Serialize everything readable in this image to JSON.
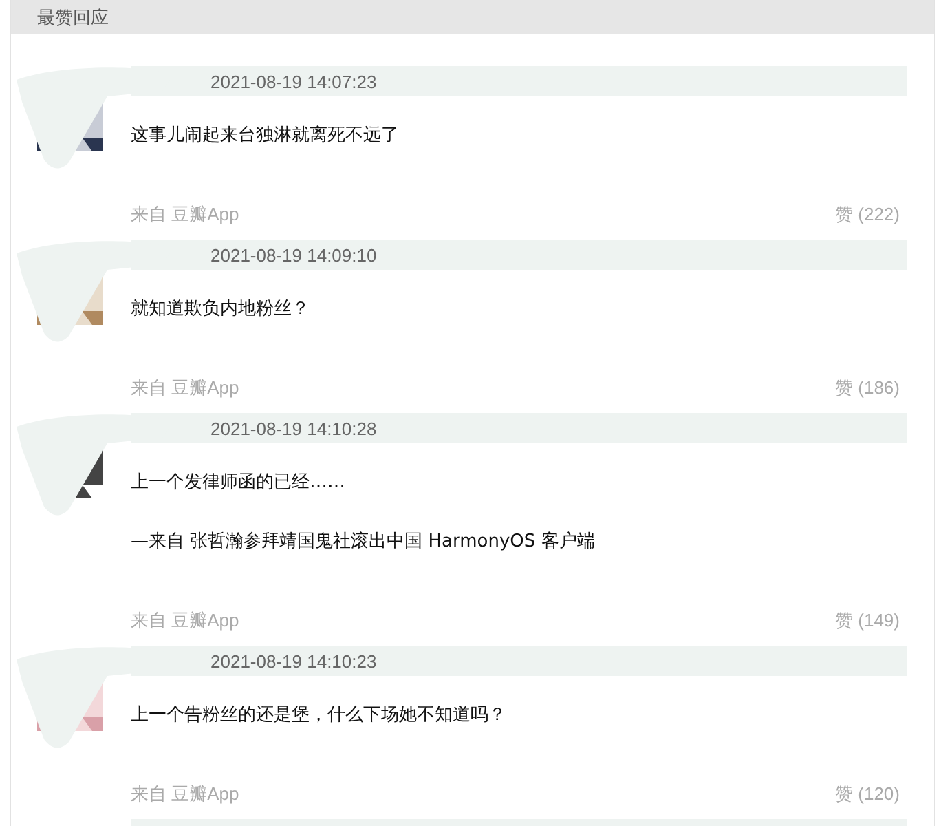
{
  "section": {
    "title": "最赞回应"
  },
  "comments": [
    {
      "timestamp": "2021-08-19 14:07:23",
      "paragraphs": [
        "这事儿闹起来台独淋就离死不远了"
      ],
      "source": "来自 豆瓣App",
      "likes": "赞 (222)"
    },
    {
      "timestamp": "2021-08-19 14:09:10",
      "paragraphs": [
        "就知道欺负内地粉丝？"
      ],
      "source": "来自 豆瓣App",
      "likes": "赞 (186)"
    },
    {
      "timestamp": "2021-08-19 14:10:28",
      "paragraphs": [
        "上一个发律师函的已经……",
        "—来自 张哲瀚参拜靖国鬼社滚出中国 HarmonyOS 客户端"
      ],
      "source": "来自 豆瓣App",
      "likes": "赞 (149)"
    },
    {
      "timestamp": "2021-08-19 14:10:23",
      "paragraphs": [
        "上一个告粉丝的还是堡，什么下场她不知道吗？"
      ],
      "source": "来自 豆瓣App",
      "likes": "赞 (120)"
    }
  ]
}
